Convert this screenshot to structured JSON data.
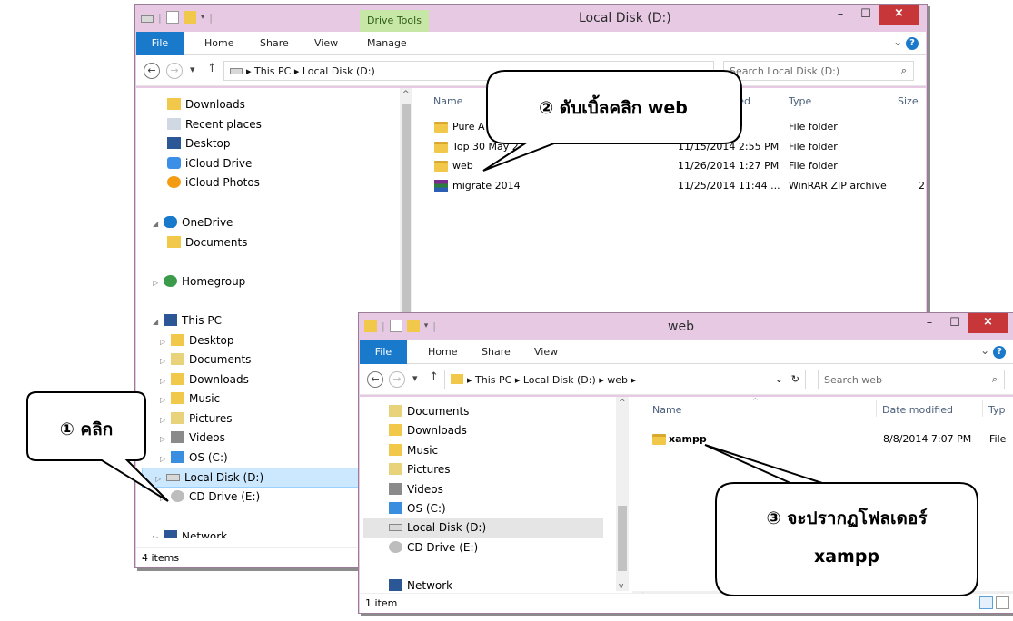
{
  "colors": {
    "file_tab": "#1979ca",
    "close_button": "#c7373a",
    "selection": "#cce8ff",
    "drive_tools": "#c7e7a6",
    "window_frame": "#e7c9e4"
  },
  "back_window": {
    "title": "Local Disk (D:)",
    "contextual_tab": "Drive Tools",
    "ribbon_tabs": [
      "File",
      "Home",
      "Share",
      "View",
      "Manage"
    ],
    "breadcrumb": [
      "This PC",
      "Local Disk (D:)"
    ],
    "search_placeholder": "Search Local Disk (D:)",
    "nav": {
      "quick_access": [
        "Downloads",
        "Recent places",
        "Desktop",
        "iCloud Drive",
        "iCloud Photos"
      ],
      "onedrive": "OneDrive",
      "onedrive_children": [
        "Documents"
      ],
      "homegroup": "Homegroup",
      "this_pc": "This PC",
      "this_pc_children": [
        "Desktop",
        "Documents",
        "Downloads",
        "Music",
        "Pictures",
        "Videos",
        "OS (C:)",
        "Local Disk (D:)",
        "CD Drive (E:)"
      ],
      "network": "Network"
    },
    "columns": [
      "Name",
      "Date modified",
      "Type",
      "Size"
    ],
    "files": [
      {
        "name": "Pure A",
        "date": "12 PM",
        "type": "File folder",
        "size": ""
      },
      {
        "name": "Top 30 May 2",
        "date": "11/15/2014 2:55 PM",
        "type": "File folder",
        "size": ""
      },
      {
        "name": "web",
        "date": "11/26/2014 1:27 PM",
        "type": "File folder",
        "size": ""
      },
      {
        "name": "migrate 2014",
        "date": "11/25/2014 11:44 ...",
        "type": "WinRAR ZIP archive",
        "size": "2"
      }
    ],
    "status": "4 items"
  },
  "front_window": {
    "title": "web",
    "ribbon_tabs": [
      "File",
      "Home",
      "Share",
      "View"
    ],
    "breadcrumb": [
      "This PC",
      "Local Disk (D:)",
      "web"
    ],
    "search_placeholder": "Search web",
    "nav": [
      "Documents",
      "Downloads",
      "Music",
      "Pictures",
      "Videos",
      "OS (C:)",
      "Local Disk (D:)",
      "CD Drive (E:)",
      "Network"
    ],
    "columns": [
      "Name",
      "Date modified",
      "Typ"
    ],
    "files": [
      {
        "name": "xampp",
        "date": "8/8/2014 7:07 PM",
        "type": "File"
      }
    ],
    "status": "1 item"
  },
  "callouts": {
    "step1": "① คลิก",
    "step2": "② ดับเบิ้ลคลิก web",
    "step3_line1": "③ จะปรากฏโฟลเดอร์",
    "step3_line2": "xampp"
  }
}
